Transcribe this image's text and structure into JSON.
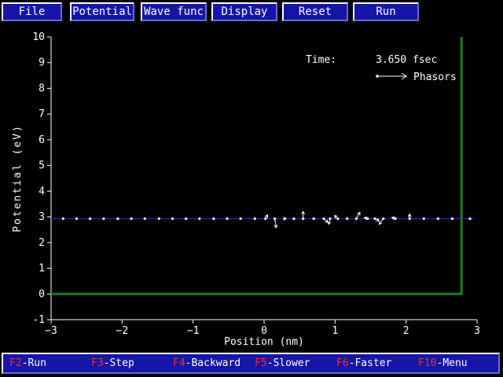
{
  "menu": [
    {
      "id": "file",
      "label": "File"
    },
    {
      "id": "potential",
      "label": "Potential"
    },
    {
      "id": "wave-func",
      "label": "Wave func"
    },
    {
      "id": "display",
      "label": "Display"
    },
    {
      "id": "reset",
      "label": "Reset"
    },
    {
      "id": "run",
      "label": "Run"
    }
  ],
  "readout": {
    "time_label": "Time:",
    "time_value": "3.650 fsec",
    "phasors_label": "Phasors"
  },
  "status_keys": [
    {
      "key": "F2",
      "sep": "-",
      "action": "Run"
    },
    {
      "key": "F3",
      "sep": "-",
      "action": "Step"
    },
    {
      "key": "F4",
      "sep": "-",
      "action": "Backward"
    },
    {
      "key": "F5",
      "sep": "-",
      "action": "Slower"
    },
    {
      "key": "F6",
      "sep": "-",
      "action": "Faster"
    },
    {
      "key": "F10",
      "sep": "-",
      "action": "Menu"
    }
  ],
  "colors": {
    "background": "#000000",
    "button_face": "#1515a8",
    "potential_line": "#1f7a1f",
    "energy_line": "#2233dd",
    "function_key": "#ff2a2a",
    "text": "#ffffff"
  },
  "chart_data": {
    "type": "line",
    "xlabel": "Position (nm)",
    "ylabel": "Potential (eV)",
    "xlim": [
      -3,
      3
    ],
    "ylim": [
      -1,
      10
    ],
    "x_ticks": [
      -3,
      -2,
      -1,
      0,
      1,
      2,
      3
    ],
    "y_ticks": [
      -1,
      0,
      1,
      2,
      3,
      4,
      5,
      6,
      7,
      8,
      9,
      10
    ],
    "grid": false,
    "series": [
      {
        "role": "potential",
        "x": [
          -3.0,
          2.78,
          2.78
        ],
        "y": [
          0,
          0,
          10
        ]
      },
      {
        "role": "energy",
        "x": [
          -3.0,
          2.95
        ],
        "y": [
          2.93,
          2.93
        ]
      }
    ],
    "phasors": {
      "y": 2.93,
      "points": [
        {
          "x": -2.83,
          "dx": 0.0,
          "dy": 0.0
        },
        {
          "x": -2.64,
          "dx": 0.0,
          "dy": 0.0
        },
        {
          "x": -2.45,
          "dx": 0.0,
          "dy": 0.0
        },
        {
          "x": -2.26,
          "dx": 0.0,
          "dy": 0.0
        },
        {
          "x": -2.06,
          "dx": 0.0,
          "dy": 0.0
        },
        {
          "x": -1.87,
          "dx": 0.0,
          "dy": 0.0
        },
        {
          "x": -1.68,
          "dx": 0.0,
          "dy": 0.0
        },
        {
          "x": -1.48,
          "dx": 0.0,
          "dy": 0.0
        },
        {
          "x": -1.29,
          "dx": 0.0,
          "dy": 0.0
        },
        {
          "x": -1.1,
          "dx": 0.0,
          "dy": 0.0
        },
        {
          "x": -0.91,
          "dx": 0.0,
          "dy": 0.0
        },
        {
          "x": -0.71,
          "dx": 0.0,
          "dy": 0.0
        },
        {
          "x": -0.52,
          "dx": 0.0,
          "dy": 0.0
        },
        {
          "x": -0.33,
          "dx": 0.0,
          "dy": 0.0
        },
        {
          "x": -0.13,
          "dx": 0.0,
          "dy": 0.0
        },
        {
          "x": 0.02,
          "dx": 0.03,
          "dy": 0.15
        },
        {
          "x": 0.15,
          "dx": 0.02,
          "dy": -0.35
        },
        {
          "x": 0.29,
          "dx": 0.02,
          "dy": 0.0
        },
        {
          "x": 0.42,
          "dx": 0.0,
          "dy": 0.0
        },
        {
          "x": 0.55,
          "dx": 0.0,
          "dy": 0.28
        },
        {
          "x": 0.7,
          "dx": 0.0,
          "dy": 0.0
        },
        {
          "x": 0.84,
          "dx": 0.06,
          "dy": -0.15
        },
        {
          "x": 0.93,
          "dx": -0.02,
          "dy": -0.22
        },
        {
          "x": 1.04,
          "dx": -0.05,
          "dy": 0.12
        },
        {
          "x": 1.17,
          "dx": 0.0,
          "dy": 0.0
        },
        {
          "x": 1.3,
          "dx": 0.05,
          "dy": 0.25
        },
        {
          "x": 1.46,
          "dx": -0.05,
          "dy": 0.04
        },
        {
          "x": 1.56,
          "dx": 0.06,
          "dy": -0.08
        },
        {
          "x": 1.68,
          "dx": -0.06,
          "dy": -0.22
        },
        {
          "x": 1.85,
          "dx": -0.05,
          "dy": 0.05
        },
        {
          "x": 2.05,
          "dx": 0.0,
          "dy": 0.18
        },
        {
          "x": 2.25,
          "dx": 0.0,
          "dy": 0.0
        },
        {
          "x": 2.45,
          "dx": 0.0,
          "dy": 0.0
        },
        {
          "x": 2.65,
          "dx": 0.0,
          "dy": 0.0
        },
        {
          "x": 2.9,
          "dx": 0.0,
          "dy": 0.0
        }
      ]
    }
  }
}
